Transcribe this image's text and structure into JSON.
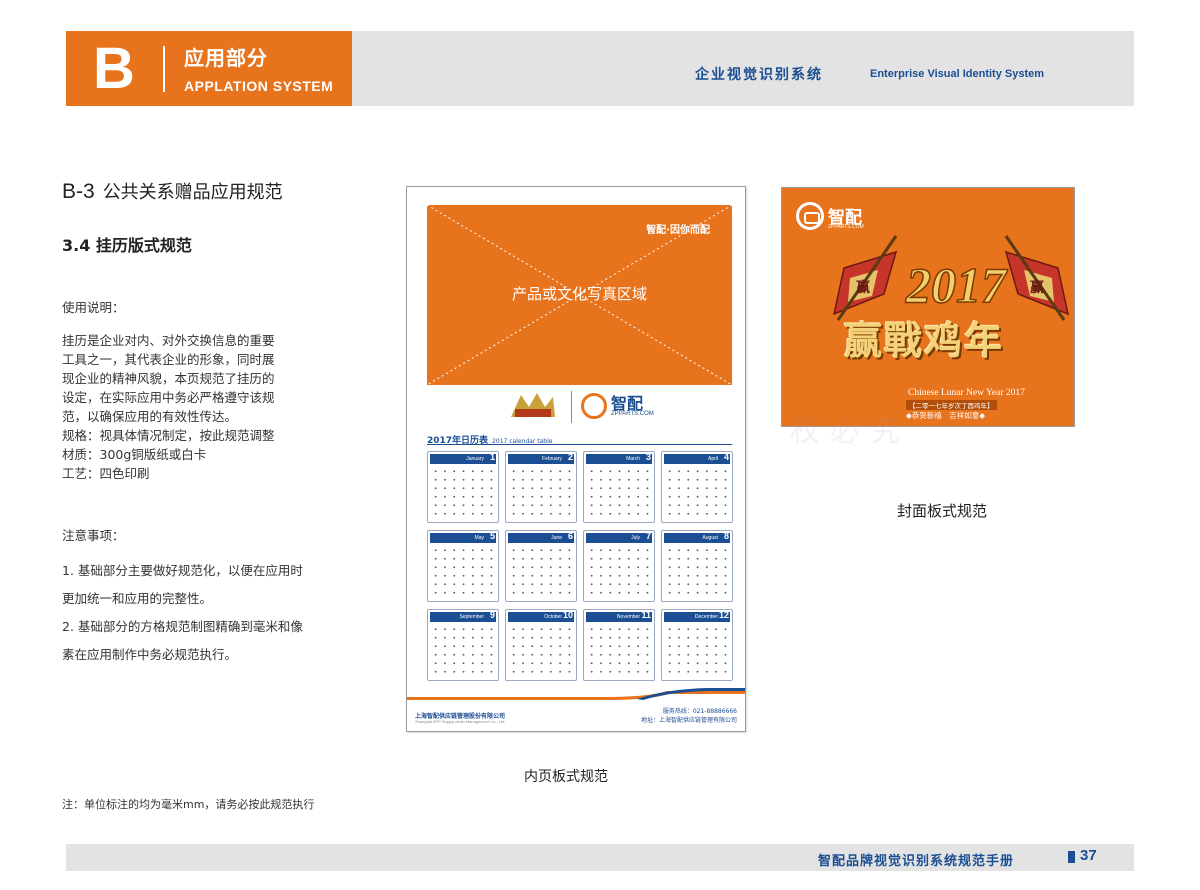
{
  "header": {
    "letter": "B",
    "section_cn": "应用部分",
    "section_en": "APPLATION SYSTEM",
    "system_cn": "企业视觉识别系统",
    "system_en": "Enterprise Visual Identity System"
  },
  "section": {
    "code": "B-3",
    "title": "公共关系赠品应用规范",
    "subtitle": "3.4 挂历版式规范"
  },
  "usage": {
    "heading": "使用说明：",
    "paragraph_lines": [
      "挂历是企业对内、对外交换信息的重要",
      "工具之一，其代表企业的形象，同时展",
      "现企业的精神风貌，本页规范了挂历的",
      "设定，在实际应用中务必严格遵守该规",
      "范，以确保应用的有效性传达。"
    ],
    "spec_lines": [
      "规格：视具体情况制定，按此规范调整",
      "材质：300g铜版纸或白卡",
      "工艺：四色印刷"
    ]
  },
  "notes": {
    "heading": "注意事项：",
    "lines": [
      "1. 基础部分主要做好规范化，以便在应用时",
      "更加统一和应用的完整性。",
      "2. 基础部分的方格规范制图精确到毫米和像",
      "素在应用制作中务必规范执行。"
    ]
  },
  "footnote": "注：单位标注的均为毫米mm，请务必按此规范执行",
  "calendar_page": {
    "slogan": "智配·因你而配",
    "photo_area": "产品或文化写真区域",
    "logo_text": "智配",
    "logo_url": "ZPPARTS.COM",
    "table_title": "2017年日历表",
    "table_title_en": "2017 calendar table",
    "months": [
      {
        "name": "January",
        "num": "1"
      },
      {
        "name": "February",
        "num": "2"
      },
      {
        "name": "March",
        "num": "3"
      },
      {
        "name": "April",
        "num": "4"
      },
      {
        "name": "May",
        "num": "5"
      },
      {
        "name": "June",
        "num": "6"
      },
      {
        "name": "July",
        "num": "7"
      },
      {
        "name": "August",
        "num": "8"
      },
      {
        "name": "September",
        "num": "9"
      },
      {
        "name": "October",
        "num": "10"
      },
      {
        "name": "November",
        "num": "11"
      },
      {
        "name": "December",
        "num": "12"
      }
    ],
    "company_cn": "上海智配供应链管理股份有限公司",
    "company_en": "Shanghai ZPP Supply chain Management Co., Ltd.",
    "hotline": "服务热线：021-88886666",
    "address": "地址：上海智配供应链管理有限公司",
    "caption": "内页板式规范"
  },
  "cover": {
    "logo_text": "智配",
    "logo_url": "ZPPARTS.COM",
    "year_art": "2017",
    "flag_char": "赢",
    "hero": "赢戰鸡年",
    "en_line": "Chinese Lunar New Year 2017",
    "line1": "【二零一七年岁次丁酉鸡年】",
    "line2": "◆恭贺新禧　吉祥如意◆",
    "caption": "封面板式规范"
  },
  "watermark": "权必究",
  "footer": {
    "title": "智配品牌视觉识别系统规范手册",
    "page": "37"
  },
  "colors": {
    "brand_orange": "#e8731d",
    "brand_blue": "#1b4e93",
    "header_gray": "#e3e3e3"
  }
}
